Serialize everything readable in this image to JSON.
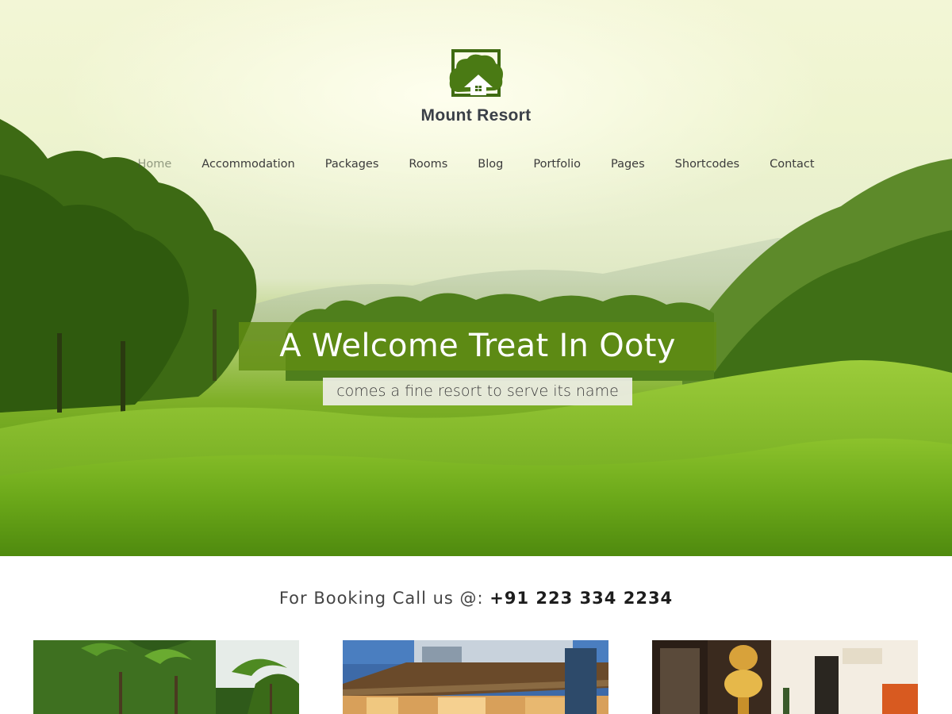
{
  "site": {
    "name": "Mount Resort",
    "logo_icon": "house-tree-icon"
  },
  "nav": {
    "items": [
      {
        "label": "Home"
      },
      {
        "label": "Accommodation"
      },
      {
        "label": "Packages"
      },
      {
        "label": "Rooms"
      },
      {
        "label": "Blog"
      },
      {
        "label": "Portfolio"
      },
      {
        "label": "Pages"
      },
      {
        "label": "Shortcodes"
      },
      {
        "label": "Contact"
      }
    ]
  },
  "hero": {
    "title": "A Welcome Treat In Ooty",
    "subtitle": "comes a fine resort to serve its name"
  },
  "booking": {
    "prefix": "For Booking Call us @: ",
    "phone": "+91 223 334 2234"
  },
  "cards": [
    {
      "image": "palm-trees-photo"
    },
    {
      "image": "resort-building-photo"
    },
    {
      "image": "hotel-lobby-photo"
    }
  ],
  "colors": {
    "accent_green": "#5f8c14",
    "logo_green": "#3f6a12",
    "text_dark": "#3a3f47"
  }
}
